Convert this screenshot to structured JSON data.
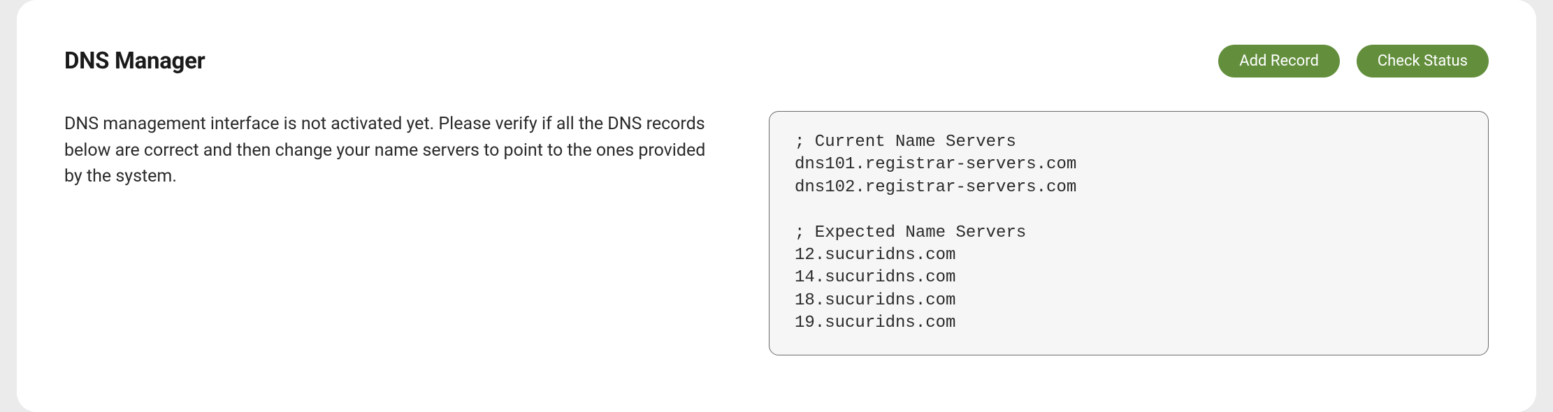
{
  "header": {
    "title": "DNS Manager",
    "buttons": {
      "add_record": "Add Record",
      "check_status": "Check Status"
    }
  },
  "main": {
    "description": "DNS management interface is not activated yet. Please verify if all the DNS records below are correct and then change your name servers to point to the ones provided by the system.",
    "code_block": "; Current Name Servers\ndns101.registrar-servers.com\ndns102.registrar-servers.com\n\n; Expected Name Servers\n12.sucuridns.com\n14.sucuridns.com\n18.sucuridns.com\n19.sucuridns.com"
  },
  "colors": {
    "button_bg": "#638f3d",
    "page_bg": "#ebebeb",
    "panel_bg": "#ffffff",
    "code_bg": "#f6f6f6",
    "code_border": "#6b6b6b"
  }
}
